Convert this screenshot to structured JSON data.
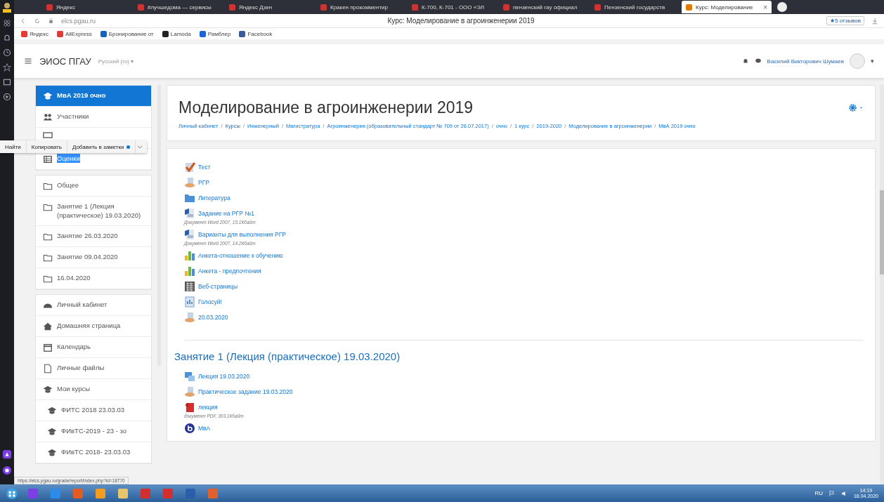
{
  "browser": {
    "tabs": [
      {
        "label": "Яндекс",
        "selected": false
      },
      {
        "label": "#лучшедома — сервисы",
        "selected": false
      },
      {
        "label": "Яндекс Дзен",
        "selected": false
      },
      {
        "label": "Кракен прокомментир",
        "selected": false
      },
      {
        "label": "К-700, К-701 - ООО «ЭЛ",
        "selected": false
      },
      {
        "label": "пензенский гау официал",
        "selected": false
      },
      {
        "label": "Пензенский государств",
        "selected": false
      },
      {
        "label": "Курс: Моделирование",
        "selected": true
      }
    ],
    "close_tab": "×",
    "address": "elcs.pgau.ru",
    "page_title": "Курс: Моделирование в агроинженерии 2019",
    "reviews": "★5 отзывов",
    "bookmarks": [
      {
        "label": "Яндекс",
        "color": "#e53935"
      },
      {
        "label": "AliExpress",
        "color": "#e53935"
      },
      {
        "label": "Бронирование от",
        "color": "#1565c0"
      },
      {
        "label": "Lamoda",
        "color": "#222222"
      },
      {
        "label": "Рамблер",
        "color": "#1e63d6"
      },
      {
        "label": "Facebook",
        "color": "#3b5998"
      }
    ],
    "status_url": "https://elcs.pgau.ru/grade/report/index.php?id=18770"
  },
  "navbar": {
    "site": "ЭИОС ПГАУ",
    "language": "Русский (ru) ▾",
    "user": "Василий Викторович Шумаев",
    "menu_caret": "▾"
  },
  "sidebar": {
    "groups": [
      [
        {
          "label": "МвА 2019 очно",
          "kind": "cap",
          "selected": true
        },
        {
          "label": "Участники",
          "kind": "users",
          "selected": false
        },
        {
          "kind": "badge",
          "selected": false
        },
        {
          "label": "Оценки",
          "kind": "table",
          "selected": false,
          "highlighted": true
        }
      ],
      [
        {
          "label": "Общее",
          "kind": "folder",
          "selected": false
        },
        {
          "label": "Занятие 1 (Лекция (практическое) 19.03.2020)",
          "kind": "folder",
          "selected": false
        },
        {
          "label": "Занятие 26.03.2020",
          "kind": "folder",
          "selected": false
        },
        {
          "label": "Занятие 09.04.2020",
          "kind": "folder",
          "selected": false
        },
        {
          "label": "16.04.2020",
          "kind": "folder",
          "selected": false
        }
      ],
      [
        {
          "label": "Личный кабинет",
          "kind": "dash",
          "selected": false
        },
        {
          "label": "Домашняя страница",
          "kind": "home",
          "selected": false
        },
        {
          "label": "Календарь",
          "kind": "calendar",
          "selected": false
        },
        {
          "label": "Личные файлы",
          "kind": "file",
          "selected": false
        },
        {
          "label": "Мои курсы",
          "kind": "cap",
          "selected": false
        },
        {
          "label": "ФИТС 2018 23.03.03",
          "kind": "cap",
          "selected": false
        },
        {
          "label": "ФИвТС-2019 - 23 - зо",
          "kind": "cap",
          "selected": false
        },
        {
          "label": "ФИвТС 2018- 23.03.03",
          "kind": "cap",
          "selected": false
        }
      ]
    ]
  },
  "context_popup": {
    "actions": [
      "Найти",
      "Копировать",
      "Добавить в заметки"
    ]
  },
  "course": {
    "title": "Моделирование в агроинженерии 2019",
    "separator": "/",
    "breadcrumbs": [
      "Личный кабинет",
      "Курсы",
      "Инженерный",
      "Магистратура",
      "Агроинженерия (образовательный стандарт № 709 от 26.07.2017)",
      "очно",
      "1 курс",
      "2019-2020",
      "Моделирование в агроинженерии",
      "МвА 2019 очно"
    ]
  },
  "sections": [
    {
      "activities": [
        {
          "kind": "quiz",
          "label": "Тест"
        },
        {
          "kind": "resource",
          "label": "РГР"
        },
        {
          "kind": "folder",
          "label": "Литература"
        },
        {
          "kind": "word",
          "label": "Задание на РГР №1",
          "description": "Документ Word 2007, 15.1Кбайт"
        },
        {
          "kind": "word",
          "label": "Варианты для выполнения РГР",
          "description": "Документ Word 2007, 14.2Кбайт"
        },
        {
          "kind": "survey",
          "label": "Анкета-отношение к обучению"
        },
        {
          "kind": "survey",
          "label": "Анкета - предпочтения"
        },
        {
          "kind": "wiki",
          "label": "Веб-страницы"
        },
        {
          "kind": "poll",
          "label": "Голосуй!"
        },
        {
          "kind": "resource",
          "label": "20.03.2020"
        }
      ]
    },
    {
      "title": "Занятие 1 (Лекция (практическое) 19.03.2020)",
      "activities": [
        {
          "kind": "lesson",
          "label": "Лекция 19.03.2020"
        },
        {
          "kind": "resource",
          "label": "Практическое задание 19.03.2020"
        },
        {
          "kind": "pdf",
          "label": "лекция",
          "description": "документ PDF, 303.1Кбайт"
        },
        {
          "kind": "bbb",
          "label": "МвА"
        }
      ]
    }
  ],
  "taskbar": {
    "language": "RU",
    "time": "14:19",
    "date": "18.04.2020"
  }
}
